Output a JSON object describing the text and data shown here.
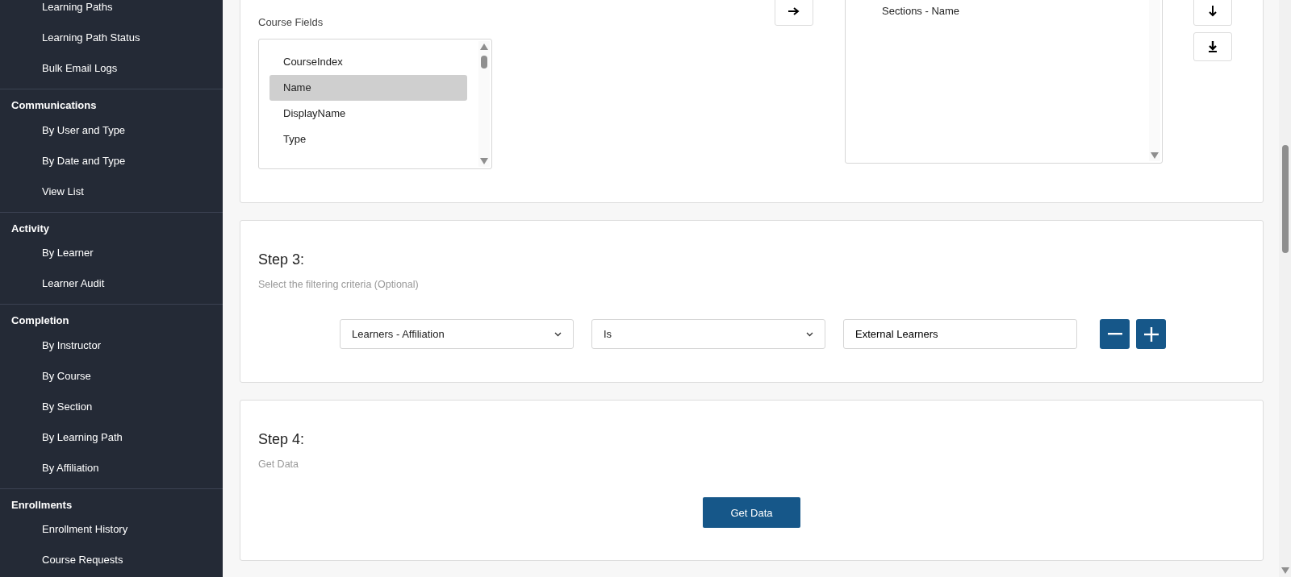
{
  "sidebar": {
    "groups": [
      {
        "items": [
          "Learning Paths",
          "Learning Path Status",
          "Bulk Email Logs"
        ]
      },
      {
        "title": "Communications",
        "items": [
          "By User and Type",
          "By Date and Type",
          "View List"
        ]
      },
      {
        "title": "Activity",
        "items": [
          "By Learner",
          "Learner Audit"
        ]
      },
      {
        "title": "Completion",
        "items": [
          "By Instructor",
          "By Course",
          "By Section",
          "By Learning Path",
          "By Affiliation"
        ]
      },
      {
        "title": "Enrollments",
        "items": [
          "Enrollment History",
          "Course Requests"
        ]
      }
    ]
  },
  "step2": {
    "fields_label": "Course Fields",
    "course_fields": [
      {
        "label": "CourseIndex",
        "selected": false
      },
      {
        "label": "Name",
        "selected": true
      },
      {
        "label": "DisplayName",
        "selected": false
      },
      {
        "label": "Type",
        "selected": false
      }
    ],
    "selected_fields": [
      {
        "label": "Sections - Name",
        "selected": false
      }
    ]
  },
  "step3": {
    "title": "Step 3:",
    "subtitle": "Select the filtering criteria (Optional)",
    "filter": {
      "field": "Learners - Affiliation",
      "operator": "Is",
      "value": "External Learners"
    }
  },
  "step4": {
    "title": "Step 4:",
    "subtitle": "Get Data",
    "button": "Get Data"
  }
}
